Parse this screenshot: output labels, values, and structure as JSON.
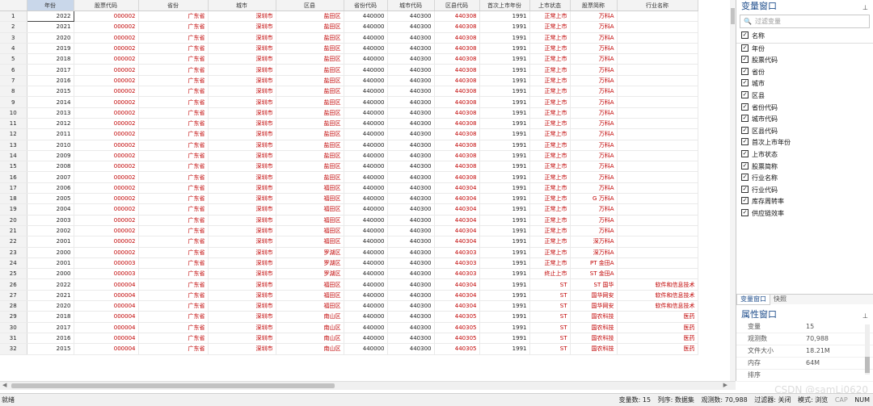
{
  "columns": [
    "年份",
    "股票代码",
    "省份",
    "城市",
    "区县",
    "省份代码",
    "城市代码",
    "区县代码",
    "首次上市年份",
    "上市状态",
    "股票简称",
    "行业名称"
  ],
  "rows": [
    [
      "2022",
      "000002",
      "广东省",
      "深圳市",
      "盐田区",
      "440000",
      "440300",
      "440308",
      "1991",
      "正常上市",
      "万科A",
      ""
    ],
    [
      "2021",
      "000002",
      "广东省",
      "深圳市",
      "盐田区",
      "440000",
      "440300",
      "440308",
      "1991",
      "正常上市",
      "万科A",
      ""
    ],
    [
      "2020",
      "000002",
      "广东省",
      "深圳市",
      "盐田区",
      "440000",
      "440300",
      "440308",
      "1991",
      "正常上市",
      "万科A",
      ""
    ],
    [
      "2019",
      "000002",
      "广东省",
      "深圳市",
      "盐田区",
      "440000",
      "440300",
      "440308",
      "1991",
      "正常上市",
      "万科A",
      ""
    ],
    [
      "2018",
      "000002",
      "广东省",
      "深圳市",
      "盐田区",
      "440000",
      "440300",
      "440308",
      "1991",
      "正常上市",
      "万科A",
      ""
    ],
    [
      "2017",
      "000002",
      "广东省",
      "深圳市",
      "盐田区",
      "440000",
      "440300",
      "440308",
      "1991",
      "正常上市",
      "万科A",
      ""
    ],
    [
      "2016",
      "000002",
      "广东省",
      "深圳市",
      "盐田区",
      "440000",
      "440300",
      "440308",
      "1991",
      "正常上市",
      "万科A",
      ""
    ],
    [
      "2015",
      "000002",
      "广东省",
      "深圳市",
      "盐田区",
      "440000",
      "440300",
      "440308",
      "1991",
      "正常上市",
      "万科A",
      ""
    ],
    [
      "2014",
      "000002",
      "广东省",
      "深圳市",
      "盐田区",
      "440000",
      "440300",
      "440308",
      "1991",
      "正常上市",
      "万科A",
      ""
    ],
    [
      "2013",
      "000002",
      "广东省",
      "深圳市",
      "盐田区",
      "440000",
      "440300",
      "440308",
      "1991",
      "正常上市",
      "万科A",
      ""
    ],
    [
      "2012",
      "000002",
      "广东省",
      "深圳市",
      "盐田区",
      "440000",
      "440300",
      "440308",
      "1991",
      "正常上市",
      "万科A",
      ""
    ],
    [
      "2011",
      "000002",
      "广东省",
      "深圳市",
      "盐田区",
      "440000",
      "440300",
      "440308",
      "1991",
      "正常上市",
      "万科A",
      ""
    ],
    [
      "2010",
      "000002",
      "广东省",
      "深圳市",
      "盐田区",
      "440000",
      "440300",
      "440308",
      "1991",
      "正常上市",
      "万科A",
      ""
    ],
    [
      "2009",
      "000002",
      "广东省",
      "深圳市",
      "盐田区",
      "440000",
      "440300",
      "440308",
      "1991",
      "正常上市",
      "万科A",
      ""
    ],
    [
      "2008",
      "000002",
      "广东省",
      "深圳市",
      "盐田区",
      "440000",
      "440300",
      "440308",
      "1991",
      "正常上市",
      "万科A",
      ""
    ],
    [
      "2007",
      "000002",
      "广东省",
      "深圳市",
      "盐田区",
      "440000",
      "440300",
      "440308",
      "1991",
      "正常上市",
      "万科A",
      ""
    ],
    [
      "2006",
      "000002",
      "广东省",
      "深圳市",
      "福田区",
      "440000",
      "440300",
      "440304",
      "1991",
      "正常上市",
      "万科A",
      ""
    ],
    [
      "2005",
      "000002",
      "广东省",
      "深圳市",
      "福田区",
      "440000",
      "440300",
      "440304",
      "1991",
      "正常上市",
      "G 万科A",
      ""
    ],
    [
      "2004",
      "000002",
      "广东省",
      "深圳市",
      "福田区",
      "440000",
      "440300",
      "440304",
      "1991",
      "正常上市",
      "万科A",
      ""
    ],
    [
      "2003",
      "000002",
      "广东省",
      "深圳市",
      "福田区",
      "440000",
      "440300",
      "440304",
      "1991",
      "正常上市",
      "万科A",
      ""
    ],
    [
      "2002",
      "000002",
      "广东省",
      "深圳市",
      "福田区",
      "440000",
      "440300",
      "440304",
      "1991",
      "正常上市",
      "万科A",
      ""
    ],
    [
      "2001",
      "000002",
      "广东省",
      "深圳市",
      "福田区",
      "440000",
      "440300",
      "440304",
      "1991",
      "正常上市",
      "深万科A",
      ""
    ],
    [
      "2000",
      "000002",
      "广东省",
      "深圳市",
      "罗湖区",
      "440000",
      "440300",
      "440303",
      "1991",
      "正常上市",
      "深万科A",
      ""
    ],
    [
      "2001",
      "000003",
      "广东省",
      "深圳市",
      "罗湖区",
      "440000",
      "440300",
      "440303",
      "1991",
      "正常上市",
      "PT 金田A",
      ""
    ],
    [
      "2000",
      "000003",
      "广东省",
      "深圳市",
      "罗湖区",
      "440000",
      "440300",
      "440303",
      "1991",
      "终止上市",
      "ST 金田A",
      ""
    ],
    [
      "2022",
      "000004",
      "广东省",
      "深圳市",
      "福田区",
      "440000",
      "440300",
      "440304",
      "1991",
      "ST",
      "ST 国华",
      "软件和信息技术"
    ],
    [
      "2021",
      "000004",
      "广东省",
      "深圳市",
      "福田区",
      "440000",
      "440300",
      "440304",
      "1991",
      "ST",
      "国华网安",
      "软件和信息技术"
    ],
    [
      "2020",
      "000004",
      "广东省",
      "深圳市",
      "福田区",
      "440000",
      "440300",
      "440304",
      "1991",
      "ST",
      "国华网安",
      "软件和信息技术"
    ],
    [
      "2018",
      "000004",
      "广东省",
      "深圳市",
      "南山区",
      "440000",
      "440300",
      "440305",
      "1991",
      "ST",
      "国农科技",
      "医药"
    ],
    [
      "2017",
      "000004",
      "广东省",
      "深圳市",
      "南山区",
      "440000",
      "440300",
      "440305",
      "1991",
      "ST",
      "国农科技",
      "医药"
    ],
    [
      "2016",
      "000004",
      "广东省",
      "深圳市",
      "南山区",
      "440000",
      "440300",
      "440305",
      "1991",
      "ST",
      "国农科技",
      "医药"
    ],
    [
      "2015",
      "000004",
      "广东省",
      "深圳市",
      "南山区",
      "440000",
      "440300",
      "440305",
      "1991",
      "ST",
      "国农科技",
      "医药"
    ]
  ],
  "var_panel": {
    "title": "变量窗口",
    "filter_placeholder": "过滤变量",
    "header": "名称",
    "variables": [
      "年份",
      "股票代码",
      "省份",
      "城市",
      "区县",
      "省份代码",
      "城市代码",
      "区县代码",
      "首次上市年份",
      "上市状态",
      "股票简称",
      "行业名称",
      "行业代码",
      "库存周转率",
      "供应链效率"
    ]
  },
  "tabs": [
    "变量窗口",
    "快照"
  ],
  "prop_panel": {
    "title": "属性窗口",
    "props": [
      {
        "k": "变量",
        "v": "15"
      },
      {
        "k": "观测数",
        "v": "70,988"
      },
      {
        "k": "文件大小",
        "v": "18.21M"
      },
      {
        "k": "内存",
        "v": "64M"
      },
      {
        "k": "排序",
        "v": ""
      }
    ]
  },
  "status": {
    "left": "就绪",
    "vars": "变量数: 15",
    "order": "列序: 数据集",
    "obs": "观测数: 70,988",
    "filter": "过滤器: 关闭",
    "mode": "模式: 浏览",
    "cap": "CAP",
    "num": "NUM"
  },
  "watermark": "CSDN @samLi0620"
}
